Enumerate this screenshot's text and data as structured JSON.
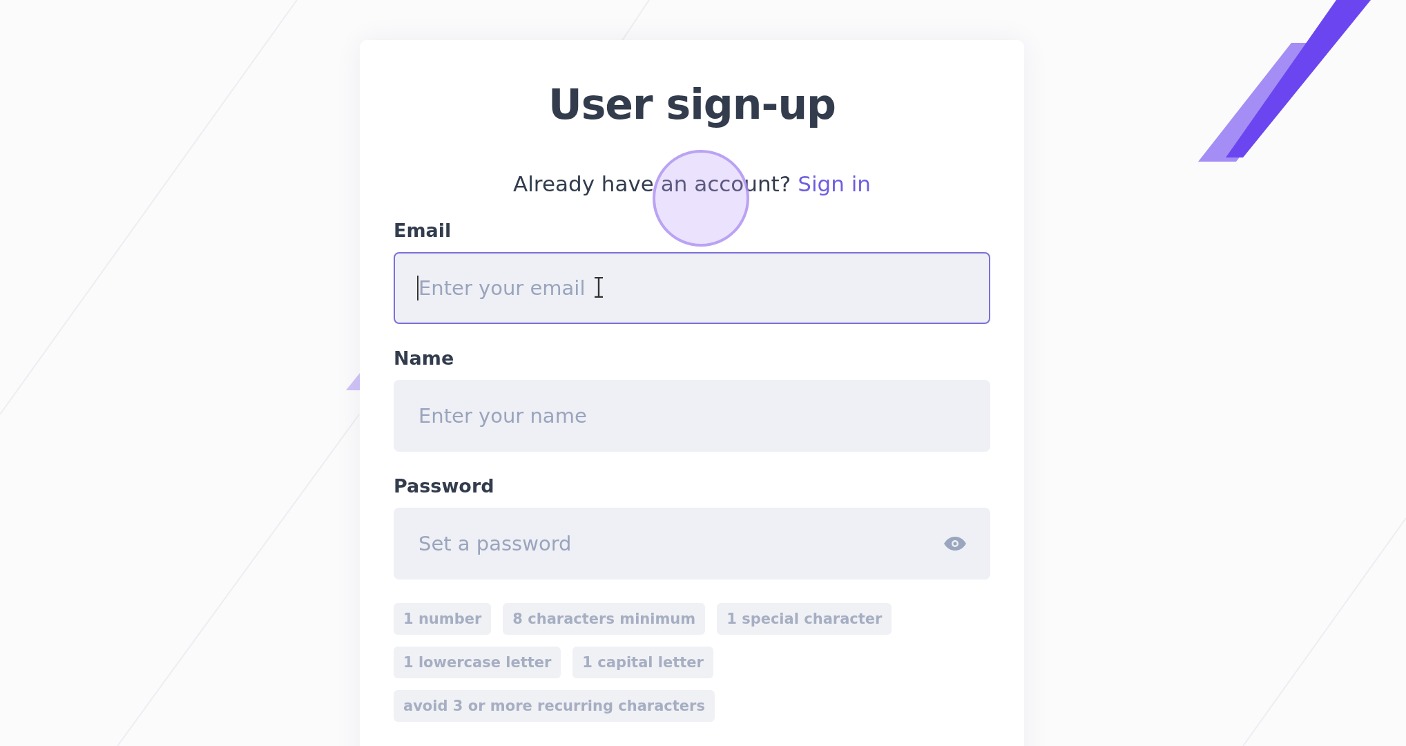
{
  "title": "User sign-up",
  "signin_prompt": {
    "text": "Already have an account?",
    "link": "Sign in"
  },
  "fields": [
    {
      "label": "Email",
      "placeholder": "Enter your email",
      "kind": "text",
      "focused": true
    },
    {
      "label": "Name",
      "placeholder": "Enter your name",
      "kind": "text",
      "focused": false
    },
    {
      "label": "Password",
      "placeholder": "Set a password",
      "kind": "password",
      "focused": false
    }
  ],
  "password_rules": [
    [
      "1 number",
      "8 characters minimum",
      "1 special character"
    ],
    [
      "1 lowercase letter",
      "1 capital letter"
    ],
    [
      "avoid 3 or more recurring characters"
    ]
  ]
}
